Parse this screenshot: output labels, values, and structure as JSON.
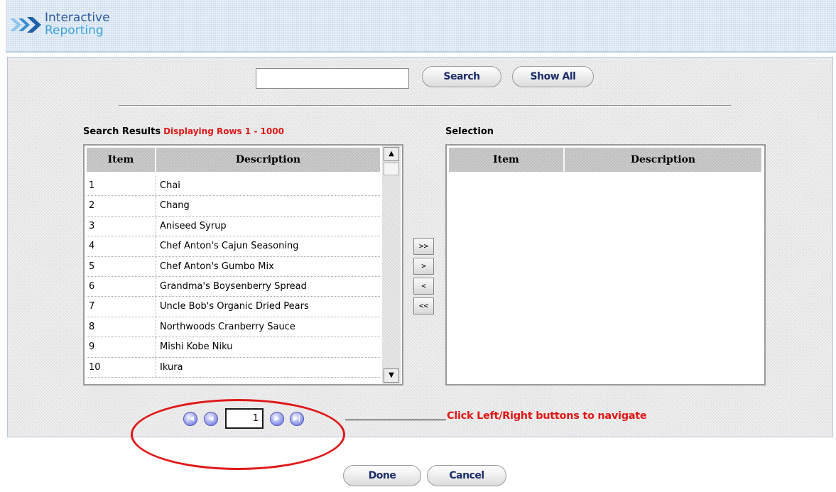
{
  "header": {
    "logo_line1": "Interactive",
    "logo_line2": "Reporting",
    "logo_icon": "double-chevron-arrow-icon"
  },
  "search": {
    "input_value": "",
    "search_label": "Search",
    "show_all_label": "Show All"
  },
  "results": {
    "label": "Search Results",
    "count_text": "Displaying Rows 1 - 1000",
    "headers": {
      "item": "Item",
      "description": "Description"
    },
    "rows": [
      {
        "item": "1",
        "description": "Chai"
      },
      {
        "item": "2",
        "description": "Chang"
      },
      {
        "item": "3",
        "description": "Aniseed Syrup"
      },
      {
        "item": "4",
        "description": "Chef Anton's Cajun Seasoning"
      },
      {
        "item": "5",
        "description": "Chef Anton's Gumbo Mix"
      },
      {
        "item": "6",
        "description": "Grandma's Boysenberry Spread"
      },
      {
        "item": "7",
        "description": "Uncle Bob's Organic Dried Pears"
      },
      {
        "item": "8",
        "description": "Northwoods Cranberry Sauce"
      },
      {
        "item": "9",
        "description": "Mishi Kobe Niku"
      },
      {
        "item": "10",
        "description": "Ikura"
      }
    ]
  },
  "selection": {
    "label": "Selection",
    "headers": {
      "item": "Item",
      "description": "Description"
    }
  },
  "transfer": {
    "move_all_right": ">>",
    "move_right": ">",
    "move_left": "<",
    "move_all_left": "<<"
  },
  "pager": {
    "page": "1",
    "callout": "Click Left/Right buttons to navigate"
  },
  "footer": {
    "done_label": "Done",
    "cancel_label": "Cancel"
  },
  "colors": {
    "accent_red": "#e01818",
    "button_text": "#1c2d6b",
    "logo_dark": "#2a5a9a",
    "logo_light": "#3aa3dc"
  }
}
